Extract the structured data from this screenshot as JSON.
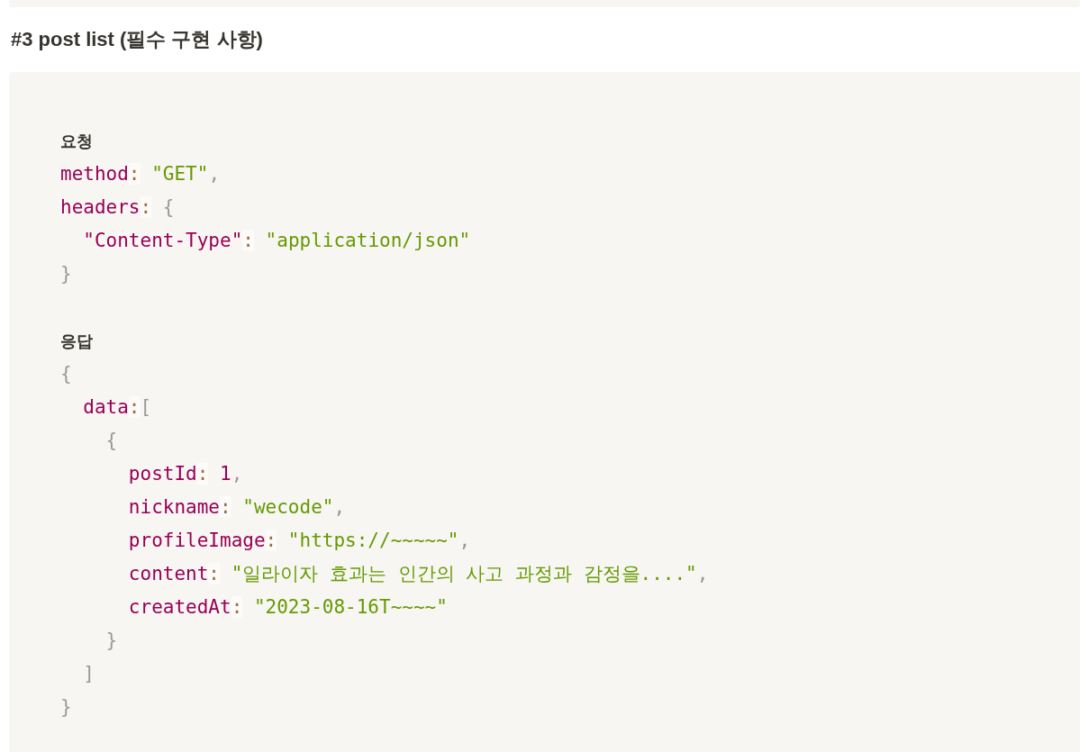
{
  "heading": "#3 post list (필수 구현 사항)",
  "sections": [
    {
      "label": "요청",
      "lines": [
        {
          "tokens": [
            {
              "kind": "key",
              "text": "method"
            },
            {
              "kind": "colon",
              "text": ":",
              "spaced": true
            },
            {
              "kind": "str",
              "text": "\"GET\""
            },
            {
              "kind": "punc",
              "text": ","
            }
          ]
        },
        {
          "tokens": [
            {
              "kind": "key",
              "text": "headers"
            },
            {
              "kind": "colon",
              "text": ":",
              "spaced": true
            },
            {
              "kind": "punc",
              "text": "{"
            }
          ],
          "children": [
            {
              "tokens": [
                {
                  "kind": "key",
                  "text": "\"Content-Type\""
                },
                {
                  "kind": "colon",
                  "text": ":",
                  "spaced": true
                },
                {
                  "kind": "str",
                  "text": "\"application/json\""
                }
              ]
            }
          ]
        },
        {
          "tokens": [
            {
              "kind": "punc",
              "text": "}"
            }
          ]
        }
      ]
    },
    {
      "label": "응답",
      "lines": [
        {
          "tokens": [
            {
              "kind": "punc",
              "text": "{"
            }
          ],
          "children": [
            {
              "tokens": [
                {
                  "kind": "key",
                  "text": "data"
                },
                {
                  "kind": "colon",
                  "text": ":",
                  "spaced": false
                },
                {
                  "kind": "punc",
                  "text": "["
                }
              ],
              "children": [
                {
                  "tokens": [
                    {
                      "kind": "punc",
                      "text": "{"
                    }
                  ],
                  "children": [
                    {
                      "tokens": [
                        {
                          "kind": "key",
                          "text": "postId"
                        },
                        {
                          "kind": "colon",
                          "text": ":",
                          "spaced": true
                        },
                        {
                          "kind": "num",
                          "text": "1"
                        },
                        {
                          "kind": "punc",
                          "text": ","
                        }
                      ]
                    },
                    {
                      "tokens": [
                        {
                          "kind": "key",
                          "text": "nickname"
                        },
                        {
                          "kind": "colon",
                          "text": ":",
                          "spaced": true
                        },
                        {
                          "kind": "str",
                          "text": "\"wecode\""
                        },
                        {
                          "kind": "punc",
                          "text": ","
                        }
                      ]
                    },
                    {
                      "tokens": [
                        {
                          "kind": "key",
                          "text": "profileImage"
                        },
                        {
                          "kind": "colon",
                          "text": ":",
                          "spaced": true
                        },
                        {
                          "kind": "str",
                          "text": "\"https://~~~~~\""
                        },
                        {
                          "kind": "punc",
                          "text": ","
                        }
                      ]
                    },
                    {
                      "tokens": [
                        {
                          "kind": "key",
                          "text": "content"
                        },
                        {
                          "kind": "colon",
                          "text": ":",
                          "spaced": true
                        },
                        {
                          "kind": "str",
                          "text": "\"일라이자 효과는 인간의 사고 과정과 감정을....\""
                        },
                        {
                          "kind": "punc",
                          "text": ","
                        }
                      ]
                    },
                    {
                      "tokens": [
                        {
                          "kind": "key",
                          "text": "createdAt"
                        },
                        {
                          "kind": "colon",
                          "text": ":",
                          "spaced": true
                        },
                        {
                          "kind": "str",
                          "text": "\"2023-08-16T~~~~\""
                        }
                      ]
                    }
                  ]
                },
                {
                  "tokens": [
                    {
                      "kind": "punc",
                      "text": "}"
                    }
                  ]
                }
              ]
            },
            {
              "tokens": [
                {
                  "kind": "punc",
                  "text": "]"
                }
              ]
            }
          ]
        },
        {
          "tokens": [
            {
              "kind": "punc",
              "text": "}"
            }
          ]
        }
      ]
    }
  ]
}
